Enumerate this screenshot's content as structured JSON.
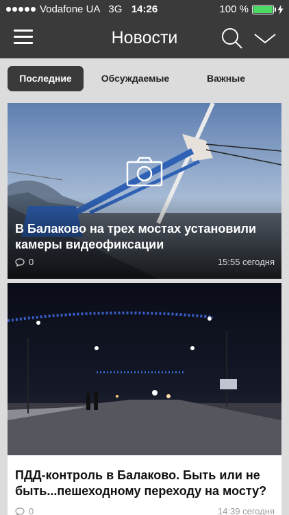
{
  "status_bar": {
    "carrier": "Vodafone UA",
    "network": "3G",
    "time": "14:26",
    "battery": "100 %",
    "battery_level": 1.0
  },
  "header": {
    "title": "Новости"
  },
  "tabs": [
    {
      "label": "Последние",
      "active": true
    },
    {
      "label": "Обсуждаемые",
      "active": false
    },
    {
      "label": "Важные",
      "active": false
    }
  ],
  "articles": [
    {
      "title": "В Балаково на трех мостах установили камеры видеофиксации",
      "comments": "0",
      "date": "15:55 сегодня"
    },
    {
      "title": "ПДД-контроль в Балаково. Быть или не быть...пешеходному переходу на мосту?",
      "comments": "0",
      "date": "14:39 сегодня"
    }
  ],
  "colors": {
    "header_bg": "#3a3a3a",
    "page_bg": "#dcdcdc",
    "battery_green": "#4cd964"
  }
}
